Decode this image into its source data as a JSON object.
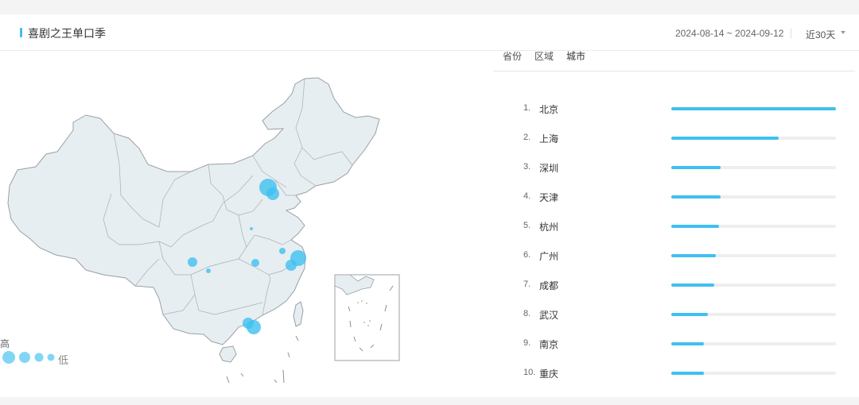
{
  "header": {
    "title": "喜剧之王单口季",
    "date_range": "2024-08-14 ~ 2024-09-12",
    "period": "近30天"
  },
  "tabs": [
    {
      "label": "省份"
    },
    {
      "label": "区域"
    },
    {
      "label": "城市"
    }
  ],
  "legend": {
    "high": "高",
    "low": "低"
  },
  "ranking": [
    {
      "rank": "1.",
      "city": "北京",
      "value": 1.0
    },
    {
      "rank": "2.",
      "city": "上海",
      "value": 0.65
    },
    {
      "rank": "3.",
      "city": "深圳",
      "value": 0.3
    },
    {
      "rank": "4.",
      "city": "天津",
      "value": 0.3
    },
    {
      "rank": "5.",
      "city": "杭州",
      "value": 0.29
    },
    {
      "rank": "6.",
      "city": "广州",
      "value": 0.27
    },
    {
      "rank": "7.",
      "city": "成都",
      "value": 0.26
    },
    {
      "rank": "8.",
      "city": "武汉",
      "value": 0.22
    },
    {
      "rank": "9.",
      "city": "南京",
      "value": 0.2
    },
    {
      "rank": "10.",
      "city": "重庆",
      "value": 0.2
    }
  ],
  "colors": {
    "accent": "#3fc0f0",
    "map_fill": "#e6eef2",
    "map_border": "#9aa0a4"
  }
}
